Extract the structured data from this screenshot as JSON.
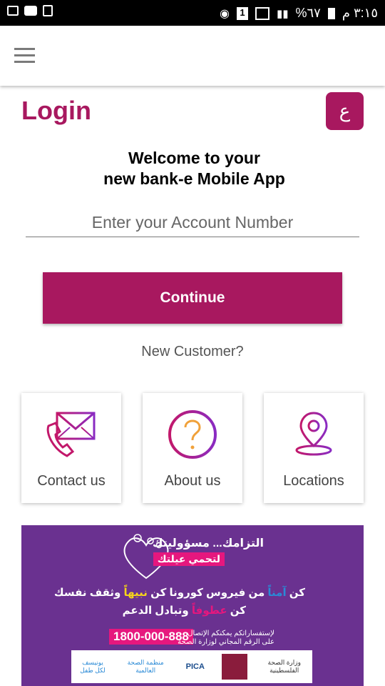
{
  "status_bar": {
    "time": "٣:١٥ م",
    "battery": "%٦٧"
  },
  "header": {
    "title": "Login",
    "lang_button": "ع"
  },
  "welcome": {
    "line1": "Welcome to your",
    "line2": "new bank-e Mobile App"
  },
  "account_input": {
    "placeholder": "Enter your Account Number",
    "value": ""
  },
  "continue_label": "Continue",
  "new_customer_label": "New Customer?",
  "cards": [
    {
      "label": "Contact us",
      "icon": "contact-envelope-phone-icon"
    },
    {
      "label": "About us",
      "icon": "question-circle-icon"
    },
    {
      "label": "Locations",
      "icon": "location-pin-icon"
    }
  ],
  "banner": {
    "line1": "التزامك... مسؤوليتك",
    "line2": "لتحمي عيلتك",
    "line3_a": "كن ",
    "line3_b": "آمناً",
    "line3_c": " من فيروس كورونا  كن ",
    "line3_d": "نبيهاً",
    "line3_e": " وثقف نفسك",
    "line4_a": "كن ",
    "line4_b": "عطوفاً",
    "line4_c": " وتبادل الدعم",
    "phone": "1800-000-888",
    "info1": "لإستفساراتكم يمكنكم الإتصال",
    "info2": "على الرقم المجاني لوزارة الصحة",
    "logo_unicef": "يونيسف",
    "logo_unicef_sub": "لكل طفل",
    "logo_who": "منظمة الصحة العالمية",
    "logo_pica": "PICA",
    "logo_ministry": "وزارة الصحة الفلسطينية"
  },
  "colors": {
    "brand": "#a8185f",
    "banner_bg": "#6a3190",
    "banner_accent": "#e6177e"
  }
}
